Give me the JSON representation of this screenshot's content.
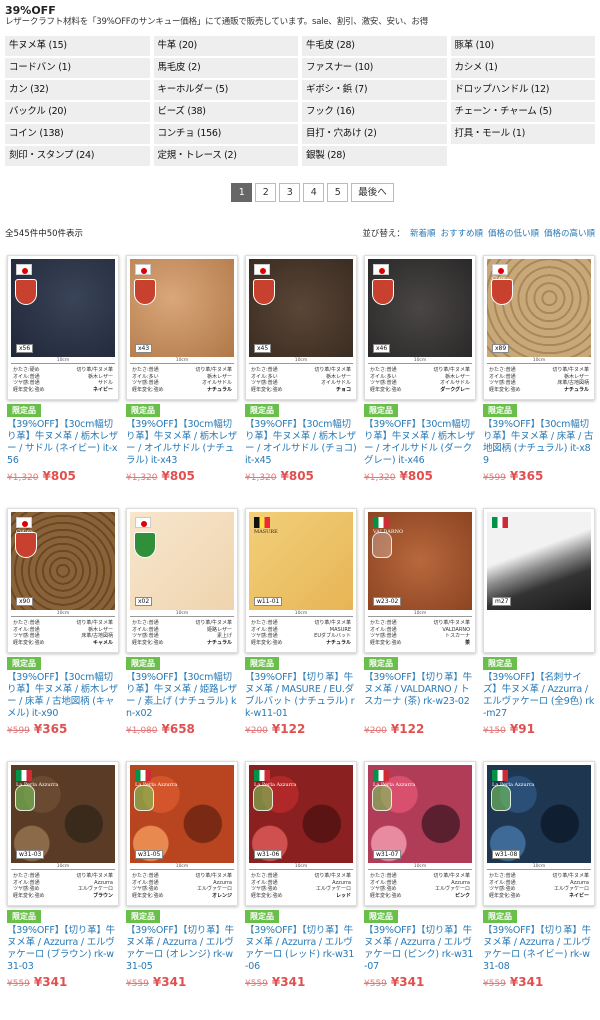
{
  "page": {
    "title": "39%OFF",
    "description": "レザークラフト材料を「39%OFFのサンキュー価格」にて通販で販売しています。sale、割引、激安、安い、お得"
  },
  "categories": [
    "牛ヌメ革 (15)",
    "牛革 (20)",
    "牛毛皮 (28)",
    "豚革 (10)",
    "コードバン (1)",
    "馬毛皮 (2)",
    "ファスナー (10)",
    "カシメ (1)",
    "カン (32)",
    "キーホルダー (5)",
    "ギボシ・鋲 (7)",
    "ドロップハンドル (12)",
    "バックル (20)",
    "ビーズ (38)",
    "フック (16)",
    "チェーン・チャーム (5)",
    "コイン (138)",
    "コンチョ (156)",
    "目打・穴あけ (2)",
    "打具・モール (1)",
    "刻印・スタンプ (24)",
    "定規・トレース (2)",
    "銀製 (28)"
  ],
  "pager": {
    "pages": [
      "1",
      "2",
      "3",
      "4",
      "5"
    ],
    "current": "1",
    "last_label": "最後へ"
  },
  "listing": {
    "count_text": "全545件中50件表示",
    "sort_label": "並び替え：",
    "sort_options": [
      "新着順",
      "おすすめ順",
      "価格の低い順",
      "価格の高い順"
    ]
  },
  "ruler_label": "10cm",
  "spec_labels": [
    "かたさ:",
    "オイル:",
    "ツヤ感:",
    "経年変化:"
  ],
  "colors": {
    "link": "#2a7ab5",
    "sale_price": "#e05050",
    "badge": "#6abf4b"
  },
  "products": [
    {
      "badge": "限定品",
      "title": "【39%OFF】【30cm幅切り革】牛ヌメ革 / 栃木レザー / サドル (ネイビー) it-x56",
      "old_price": "¥1,320",
      "price": "¥805",
      "code": "x56",
      "flag": "jp",
      "emblem": "red-shield",
      "brand": "",
      "swatch": "navy",
      "spec": [
        "硬め",
        "普通",
        "普通",
        "強め"
      ],
      "spec_right": [
        "切り革/牛ヌメ革",
        "栃木レザー",
        "サドル",
        "ネイビー"
      ]
    },
    {
      "badge": "限定品",
      "title": "【39%OFF】【30cm幅切り革】牛ヌメ革 / 栃木レザー / オイルサドル (ナチュラル) it-x43",
      "old_price": "¥1,320",
      "price": "¥805",
      "code": "x43",
      "flag": "jp",
      "emblem": "red-shield",
      "brand": "",
      "swatch": "tan",
      "spec": [
        "普通",
        "多い",
        "普通",
        "強め"
      ],
      "spec_right": [
        "切り革/牛ヌメ革",
        "栃木レザー",
        "オイルサドル",
        "ナチュラル"
      ]
    },
    {
      "badge": "限定品",
      "title": "【39%OFF】【30cm幅切り革】牛ヌメ革 / 栃木レザー / オイルサドル (チョコ) it-x45",
      "old_price": "¥1,320",
      "price": "¥805",
      "code": "x45",
      "flag": "jp",
      "emblem": "red-shield",
      "brand": "",
      "swatch": "choco",
      "spec": [
        "普通",
        "多い",
        "普通",
        "強め"
      ],
      "spec_right": [
        "切り革/牛ヌメ革",
        "栃木レザー",
        "オイルサドル",
        "チョコ"
      ]
    },
    {
      "badge": "限定品",
      "title": "【39%OFF】【30cm幅切り革】牛ヌメ革 / 栃木レザー / オイルサドル (ダークグレー) it-x46",
      "old_price": "¥1,320",
      "price": "¥805",
      "code": "x46",
      "flag": "jp",
      "emblem": "red-shield",
      "brand": "",
      "swatch": "darkgray",
      "spec": [
        "普通",
        "多い",
        "普通",
        "強め"
      ],
      "spec_right": [
        "切り革/牛ヌメ革",
        "栃木レザー",
        "オイルサドル",
        "ダークグレー"
      ]
    },
    {
      "badge": "限定品",
      "title": "【39%OFF】【30cm幅切り革】牛ヌメ革 / 床革 / 古地図柄 (ナチュラル) it-x89",
      "old_price": "¥599",
      "price": "¥365",
      "code": "x89",
      "flag": "jp",
      "emblem": "red-shield",
      "brand": "Cutina",
      "swatch": "map-light",
      "spec": [
        "普通",
        "普通",
        "普通",
        "強め"
      ],
      "spec_right": [
        "切り革/牛ヌメ革",
        "栃木レザー",
        "床革/古地図柄",
        "ナチュラル"
      ]
    },
    {
      "badge": "限定品",
      "title": "【39%OFF】【30cm幅切り革】牛ヌメ革 / 栃木レザー / 床革 / 古地図柄 (キャメル) it-x90",
      "old_price": "¥599",
      "price": "¥365",
      "code": "x90",
      "flag": "jp",
      "emblem": "red-shield",
      "brand": "Cutina",
      "swatch": "map-dark",
      "spec": [
        "普通",
        "普通",
        "普通",
        "強め"
      ],
      "spec_right": [
        "切り革/牛ヌメ革",
        "栃木レザー",
        "床革/古地図柄",
        "キャメル"
      ]
    },
    {
      "badge": "限定品",
      "title": "【39%OFF】【30cm幅切り革】牛ヌメ革 / 姫路レザー / 素上げ (ナチュラル) kn-x02",
      "old_price": "¥1,080",
      "price": "¥658",
      "code": "x02",
      "flag": "jp",
      "emblem": "green-shield",
      "brand": "",
      "swatch": "cream",
      "spec": [
        "普通",
        "普通",
        "普通",
        "強め"
      ],
      "spec_right": [
        "切り革/牛ヌメ革",
        "姫路レザー",
        "素上げ",
        "ナチュラル"
      ]
    },
    {
      "badge": "限定品",
      "title": "【39%OFF】【切り革】牛ヌメ革 / MASURE / EU.ダブルバット (ナチュラル) rk-w11-01",
      "old_price": "¥200",
      "price": "¥122",
      "code": "w11-01",
      "flag": "be",
      "emblem": "",
      "brand": "MASURE",
      "swatch": "yellow",
      "spec": [
        "普通",
        "普通",
        "普通",
        "強め"
      ],
      "spec_right": [
        "切り革/牛ヌメ革",
        "MASURE",
        "EUダブルバット",
        "ナチュラル"
      ]
    },
    {
      "badge": "限定品",
      "title": "【39%OFF】【切り革】牛ヌメ革 / VALDARNO / トスカーナ (茶) rk-w23-02",
      "old_price": "¥200",
      "price": "¥122",
      "code": "w23-02",
      "flag": "it",
      "emblem": "hand",
      "brand": "VALDARNO",
      "swatch": "rust",
      "spec": [
        "普通",
        "普通",
        "普通",
        "強め"
      ],
      "spec_right": [
        "切り革/牛ヌメ革",
        "VALDARNO",
        "トスカーナ",
        "茶"
      ]
    },
    {
      "badge": "限定品",
      "title": "【39%OFF】【名刺サイズ】牛ヌメ革 / Azzurra / エルヴァケーロ (全9色) rk-m27",
      "old_price": "¥150",
      "price": "¥91",
      "code": "m27",
      "flag": "it",
      "emblem": "",
      "brand": "",
      "swatch": "photo",
      "spec": [],
      "spec_right": []
    },
    {
      "badge": "限定品",
      "title": "【39%OFF】【切り革】牛ヌメ革 / Azzurra / エルヴァケーロ (ブラウン) rk-w31-03",
      "old_price": "¥559",
      "price": "¥341",
      "code": "w31-03",
      "flag": "it",
      "emblem": "hand-green",
      "brand": "La Perla Azzurra",
      "swatch": "camo-brown",
      "spec": [
        "普通",
        "普通",
        "強め",
        "強め"
      ],
      "spec_right": [
        "切り革/牛ヌメ革",
        "Azzurra",
        "エルヴァケーロ",
        "ブラウン"
      ]
    },
    {
      "badge": "限定品",
      "title": "【39%OFF】【切り革】牛ヌメ革 / Azzurra / エルヴァケーロ (オレンジ) rk-w31-05",
      "old_price": "¥559",
      "price": "¥341",
      "code": "w31-05",
      "flag": "it",
      "emblem": "hand-green",
      "brand": "La Perla Azzurra",
      "swatch": "camo-orange",
      "spec": [
        "普通",
        "普通",
        "強め",
        "強め"
      ],
      "spec_right": [
        "切り革/牛ヌメ革",
        "Azzurra",
        "エルヴァケーロ",
        "オレンジ"
      ]
    },
    {
      "badge": "限定品",
      "title": "【39%OFF】【切り革】牛ヌメ革 / Azzurra / エルヴァケーロ (レッド) rk-w31-06",
      "old_price": "¥559",
      "price": "¥341",
      "code": "w31-06",
      "flag": "it",
      "emblem": "hand-green",
      "brand": "La Perla Azzurra",
      "swatch": "camo-red",
      "spec": [
        "普通",
        "普通",
        "強め",
        "強め"
      ],
      "spec_right": [
        "切り革/牛ヌメ革",
        "Azzurra",
        "エルヴァケーロ",
        "レッド"
      ]
    },
    {
      "badge": "限定品",
      "title": "【39%OFF】【切り革】牛ヌメ革 / Azzurra / エルヴァケーロ (ピンク) rk-w31-07",
      "old_price": "¥559",
      "price": "¥341",
      "code": "w31-07",
      "flag": "it",
      "emblem": "hand-green",
      "brand": "La Perla Azzurra",
      "swatch": "camo-pink",
      "spec": [
        "普通",
        "普通",
        "強め",
        "強め"
      ],
      "spec_right": [
        "切り革/牛ヌメ革",
        "Azzurra",
        "エルヴァケーロ",
        "ピンク"
      ]
    },
    {
      "badge": "限定品",
      "title": "【39%OFF】【切り革】牛ヌメ革 / Azzurra / エルヴァケーロ (ネイビー) rk-w31-08",
      "old_price": "¥559",
      "price": "¥341",
      "code": "w31-08",
      "flag": "it",
      "emblem": "hand-green",
      "brand": "La Perla Azzurra",
      "swatch": "camo-navy",
      "spec": [
        "普通",
        "普通",
        "強め",
        "強め"
      ],
      "spec_right": [
        "切り革/牛ヌメ革",
        "Azzurra",
        "エルヴァケーロ",
        "ネイビー"
      ]
    }
  ]
}
